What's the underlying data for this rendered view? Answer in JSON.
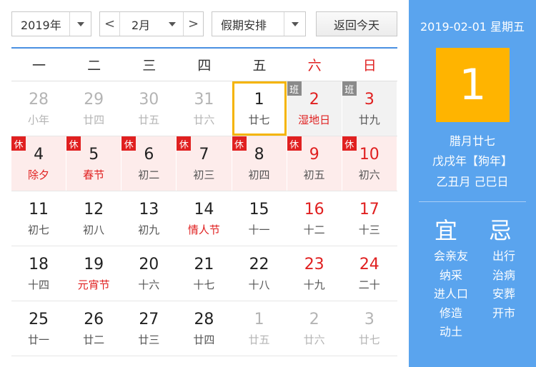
{
  "toolbar": {
    "year": "2019年",
    "month": "2月",
    "prev": "<",
    "next": ">",
    "holiday_select": "假期安排",
    "today_button": "返回今天"
  },
  "weekdays": [
    {
      "label": "一",
      "red": false
    },
    {
      "label": "二",
      "red": false
    },
    {
      "label": "三",
      "red": false
    },
    {
      "label": "四",
      "red": false
    },
    {
      "label": "五",
      "red": false
    },
    {
      "label": "六",
      "red": true
    },
    {
      "label": "日",
      "red": true
    }
  ],
  "weeks": [
    [
      {
        "d": "28",
        "l": "小年",
        "other": true
      },
      {
        "d": "29",
        "l": "廿四",
        "other": true
      },
      {
        "d": "30",
        "l": "廿五",
        "other": true
      },
      {
        "d": "31",
        "l": "廿六",
        "other": true
      },
      {
        "d": "1",
        "l": "廿七",
        "today": true
      },
      {
        "d": "2",
        "l": "湿地日",
        "weekend": true,
        "fest": true,
        "tag": "班",
        "tagType": "work"
      },
      {
        "d": "3",
        "l": "廿九",
        "weekend": true,
        "tag": "班",
        "tagType": "work"
      }
    ],
    [
      {
        "d": "4",
        "l": "除夕",
        "fest": true,
        "tag": "休",
        "tagType": "rest"
      },
      {
        "d": "5",
        "l": "春节",
        "fest": true,
        "tag": "休",
        "tagType": "rest"
      },
      {
        "d": "6",
        "l": "初二",
        "tag": "休",
        "tagType": "rest"
      },
      {
        "d": "7",
        "l": "初三",
        "tag": "休",
        "tagType": "rest"
      },
      {
        "d": "8",
        "l": "初四",
        "tag": "休",
        "tagType": "rest"
      },
      {
        "d": "9",
        "l": "初五",
        "weekend": true,
        "tag": "休",
        "tagType": "rest"
      },
      {
        "d": "10",
        "l": "初六",
        "weekend": true,
        "tag": "休",
        "tagType": "rest"
      }
    ],
    [
      {
        "d": "11",
        "l": "初七"
      },
      {
        "d": "12",
        "l": "初八"
      },
      {
        "d": "13",
        "l": "初九"
      },
      {
        "d": "14",
        "l": "情人节",
        "fest": true
      },
      {
        "d": "15",
        "l": "十一"
      },
      {
        "d": "16",
        "l": "十二",
        "weekend": true
      },
      {
        "d": "17",
        "l": "十三",
        "weekend": true
      }
    ],
    [
      {
        "d": "18",
        "l": "十四"
      },
      {
        "d": "19",
        "l": "元宵节",
        "fest": true
      },
      {
        "d": "20",
        "l": "十六"
      },
      {
        "d": "21",
        "l": "十七"
      },
      {
        "d": "22",
        "l": "十八"
      },
      {
        "d": "23",
        "l": "十九",
        "weekend": true
      },
      {
        "d": "24",
        "l": "二十",
        "weekend": true
      }
    ],
    [
      {
        "d": "25",
        "l": "廿一"
      },
      {
        "d": "26",
        "l": "廿二"
      },
      {
        "d": "27",
        "l": "廿三"
      },
      {
        "d": "28",
        "l": "廿四"
      },
      {
        "d": "1",
        "l": "廿五",
        "other": true
      },
      {
        "d": "2",
        "l": "廿六",
        "other": true
      },
      {
        "d": "3",
        "l": "廿七",
        "other": true
      }
    ]
  ],
  "side": {
    "date_line": "2019-02-01 星期五",
    "big_day": "1",
    "lunar_date": "腊月廿七",
    "year_info": "戊戌年【狗年】",
    "month_day_info": "乙丑月 己巳日",
    "yi_label": "宜",
    "ji_label": "忌",
    "yi_items": [
      "会亲友",
      "纳采",
      "进人口",
      "修造",
      "动土"
    ],
    "ji_items": [
      "出行",
      "治病",
      "安葬",
      "开市"
    ]
  },
  "colors": {
    "accent": "#4a90e2",
    "side_bg": "#5aa4ee",
    "today_border": "#f5b400",
    "big_day_bg": "#ffb400",
    "holiday_red": "#e02020",
    "holiday_bg": "#fdeceb"
  }
}
